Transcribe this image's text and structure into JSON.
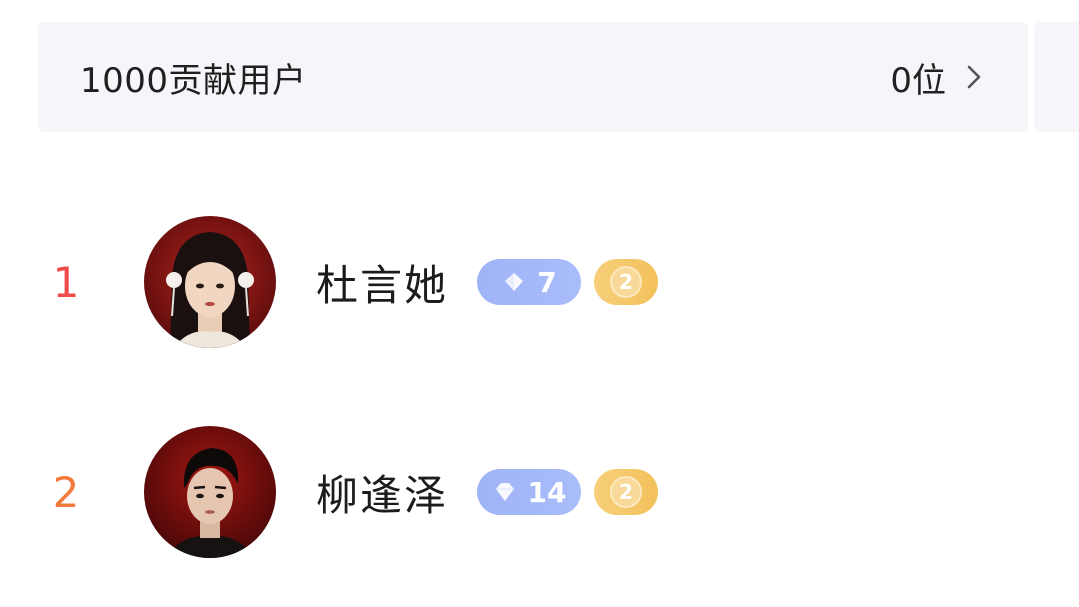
{
  "contributors": {
    "title": "1000贡献用户",
    "count": "0位",
    "chevron_icon": "chevron-right-icon"
  },
  "ranking": [
    {
      "rank": "1",
      "rank_color": "#ef4b4b",
      "name": "杜言她",
      "avatar_icon": "female-avatar",
      "gem_level": "7",
      "coin_level": "2"
    },
    {
      "rank": "2",
      "rank_color": "#f27a3c",
      "name": "柳逢泽",
      "avatar_icon": "male-avatar",
      "gem_level": "14",
      "coin_level": "2"
    }
  ],
  "colors": {
    "gem_badge": "#a5b8f9",
    "coin_badge": "#f5c86a",
    "bar_bg": "#f6f6fa"
  }
}
